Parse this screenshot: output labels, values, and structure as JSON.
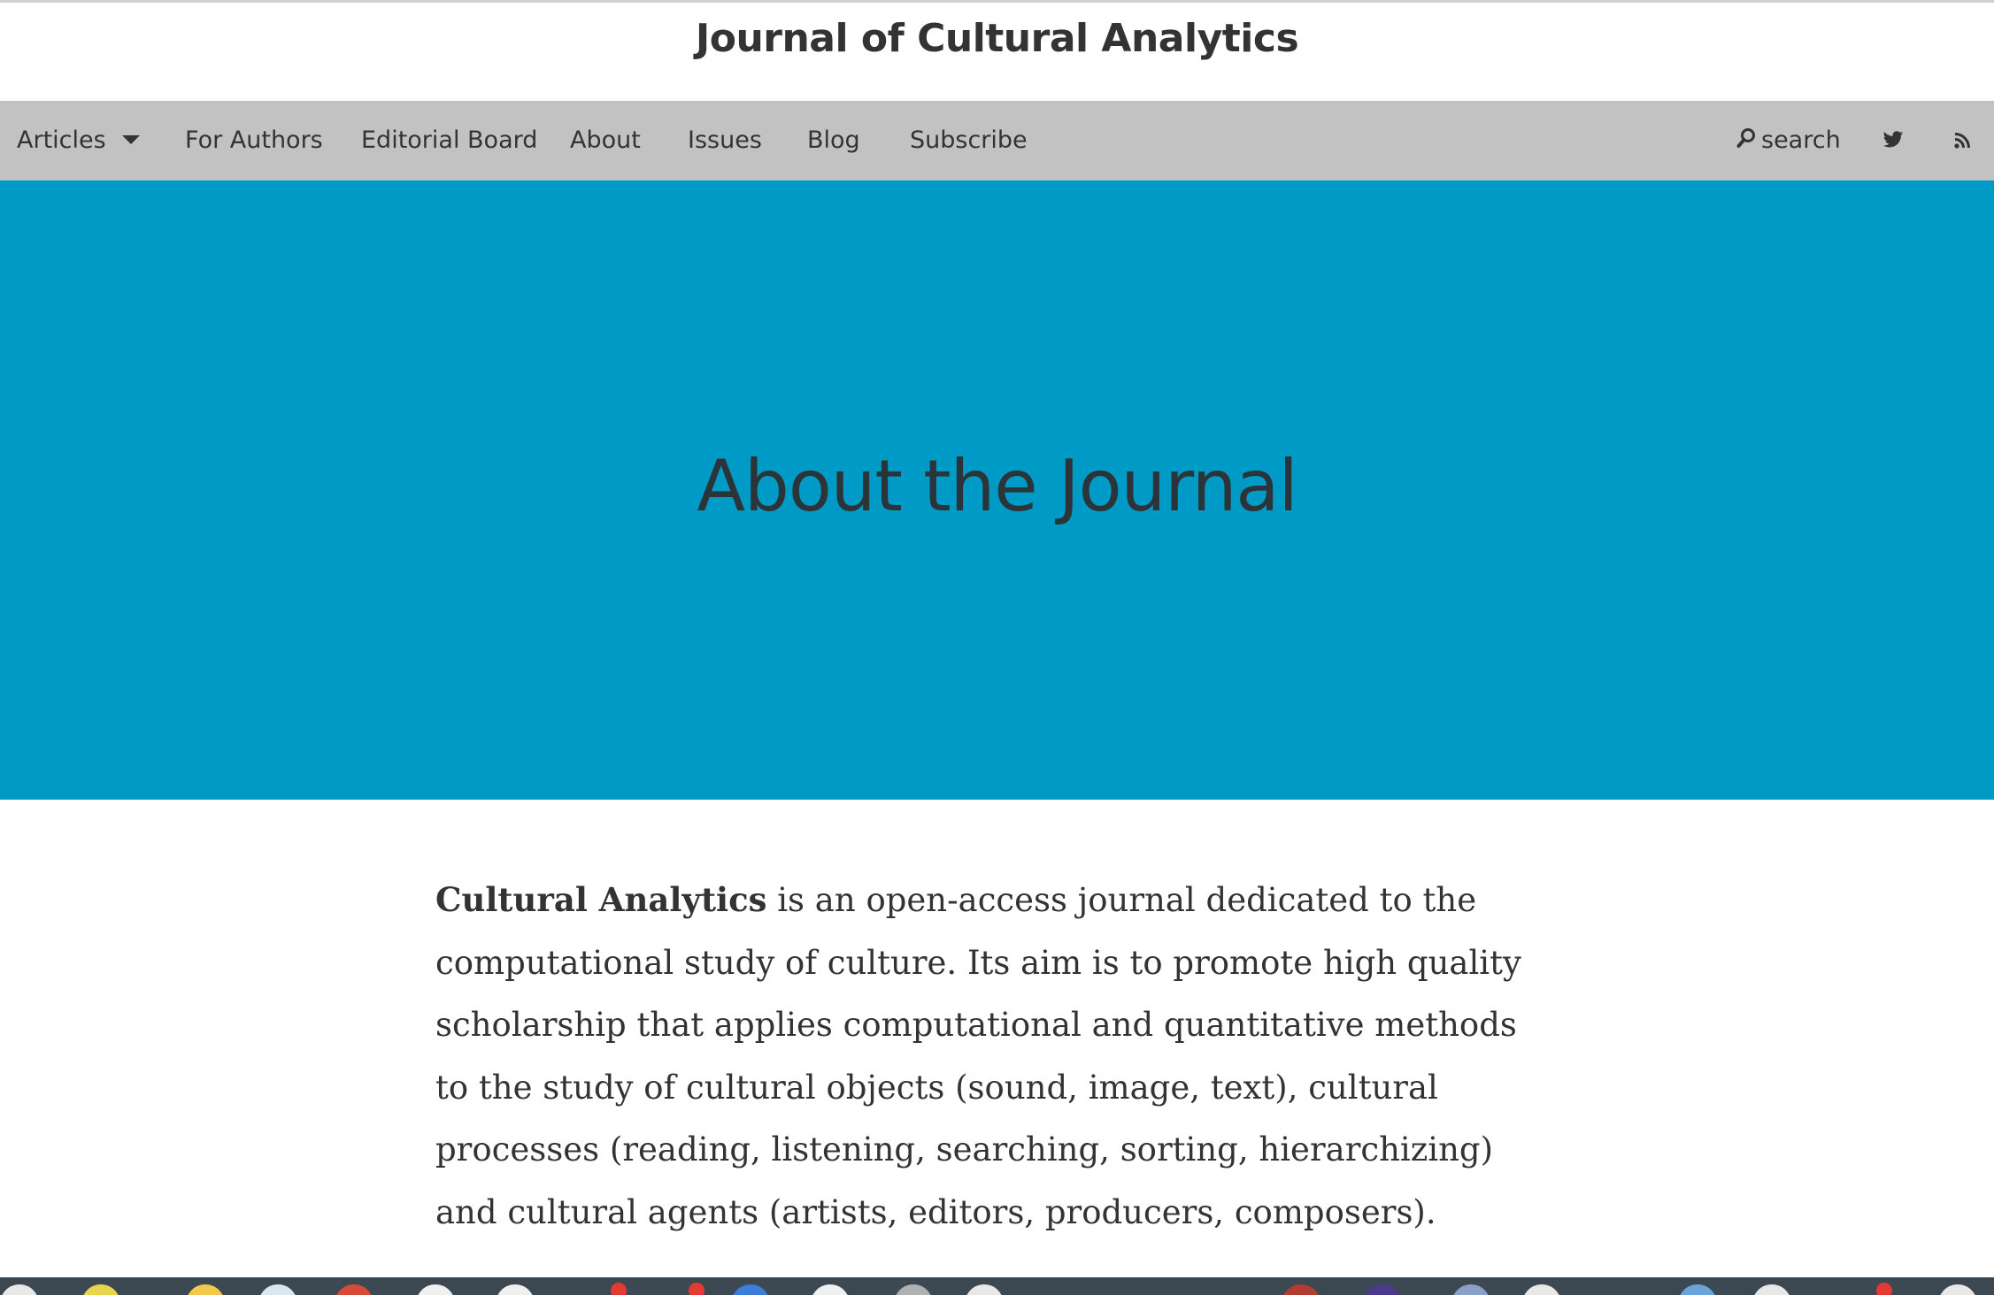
{
  "header": {
    "site_title": "Journal of Cultural Analytics"
  },
  "nav": {
    "items": [
      {
        "label": "Articles",
        "has_dropdown": true
      },
      {
        "label": "For Authors"
      },
      {
        "label": "Editorial Board"
      },
      {
        "label": "About"
      },
      {
        "label": "Issues"
      },
      {
        "label": "Blog"
      },
      {
        "label": "Subscribe"
      }
    ],
    "search_label": "search",
    "right_icons": [
      "search-icon",
      "twitter-icon",
      "rss-icon"
    ]
  },
  "hero": {
    "title": "About the Journal",
    "background_color": "#009ac7"
  },
  "content": {
    "intro_bold": "Cultural Analytics",
    "intro_rest": " is an open-access journal dedicated to the computational study of culture. Its aim is to promote high quality scholarship that applies computational and quantitative methods to the study of cultural objects (sound, image, text), cultural processes (reading, listening, searching, sorting, hierarchizing) and cultural agents (artists, editors, producers, composers)."
  },
  "colors": {
    "navbar": "#c2c2c2",
    "text": "#333333",
    "hero_text": "#2b3539",
    "dock": "#3c4852"
  }
}
